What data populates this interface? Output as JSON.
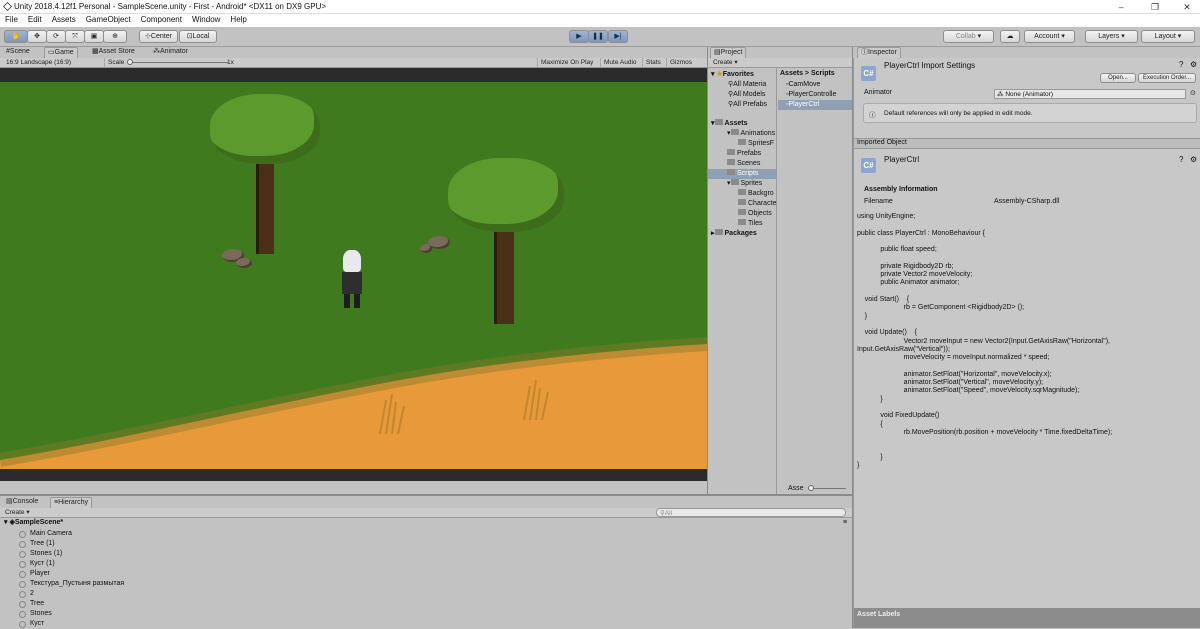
{
  "window": {
    "title": "Unity 2018.4.12f1 Personal - SampleScene.unity - First - Android* <DX11 on DX9 GPU>",
    "min": "–",
    "max": "❐",
    "close": "✕"
  },
  "menu": [
    "File",
    "Edit",
    "Assets",
    "GameObject",
    "Component",
    "Window",
    "Help"
  ],
  "toolbar": {
    "center": "Center",
    "local": "Local",
    "collab": "Collab",
    "account": "Account",
    "layers": "Layers",
    "layout": "Layout",
    "arrow": "▾"
  },
  "tabs": {
    "scene": "Scene",
    "game": "Game",
    "asset_store": "Asset Store",
    "animator": "Animator",
    "project": "Project",
    "inspector": "Inspector",
    "console": "Console",
    "hierarchy": "Hierarchy"
  },
  "game_bar": {
    "aspect": "16:9 Landscape (16:9)",
    "scale_label": "Scale",
    "scale_value": "1x",
    "maximize": "Maximize On Play",
    "mute": "Mute Audio",
    "stats": "Stats",
    "gizmos": "Gizmos"
  },
  "project": {
    "create": "Create",
    "breadcrumb_assets": "Assets",
    "breadcrumb_sep": ">",
    "breadcrumb_scripts": "Scripts",
    "favorites_label": "Favorites",
    "favorites": [
      "All Materia",
      "All Models",
      "All Prefabs"
    ],
    "assets_label": "Assets",
    "tree": [
      "Animations",
      "SpritesF",
      "Prefabs",
      "Scenes",
      "Scripts",
      "Sprites",
      "Backgro",
      "Characte",
      "Objects",
      "Tiles"
    ],
    "packages_label": "Packages",
    "files": [
      "CamMove",
      "PlayerControlle",
      "PlayerCtrl"
    ],
    "footer": "Asse"
  },
  "inspector": {
    "title": "PlayerCtrl Import Settings",
    "open": "Open...",
    "exec_order": "Execution Order...",
    "animator_label": "Animator",
    "animator_value": "None (Animator)",
    "info": "Default references will only be applied in edit mode.",
    "imported_object": "Imported Object",
    "object_name": "PlayerCtrl",
    "assembly_heading": "Assembly Information",
    "filename_label": "Filename",
    "filename_value": "Assembly-CSharp.dll",
    "asset_labels": "Asset Labels",
    "cs": "C#"
  },
  "code_lines": [
    "using UnityEngine;",
    "",
    "public class PlayerCtrl : MonoBehaviour {",
    "",
    "            public float speed;",
    "",
    "            private Rigidbody2D rb;",
    "            private Vector2 moveVelocity;",
    "            public Animator animator;",
    "",
    "    void Start()    {",
    "                        rb = GetComponent <Rigidbody2D> ();",
    "    }",
    "",
    "    void Update()    {",
    "                        Vector2 moveInput = new Vector2(Input.GetAxisRaw(\"Horizontal\"),",
    "Input.GetAxisRaw(\"Vertical\"));",
    "                        moveVelocity = moveInput.normalized * speed;",
    "",
    "                        animator.SetFloat(\"Horizontal\", moveVelocity.x);",
    "                        animator.SetFloat(\"Vertical\", moveVelocity.y);",
    "                        animator.SetFloat(\"Speed\", moveVelocity.sqrMagnitude);",
    "            }",
    "",
    "            void FixedUpdate()",
    "            {",
    "                        rb.MovePosition(rb.position + moveVelocity * Time.fixedDeltaTime);",
    "",
    "",
    "            }",
    "}"
  ],
  "hierarchy": {
    "create": "Create",
    "search_placeholder": "All",
    "scene": "SampleScene*",
    "items": [
      "Main Camera",
      "Tree (1)",
      "Stones (1)",
      "Куст (1)",
      "Player",
      "Текстура_Пустыня размытая",
      "2",
      "Tree",
      "Stones",
      "Куст"
    ]
  },
  "colors": {
    "play_active": "#8aa2c8",
    "grass": "#3f7a1f",
    "sand": "#e89a3a"
  }
}
